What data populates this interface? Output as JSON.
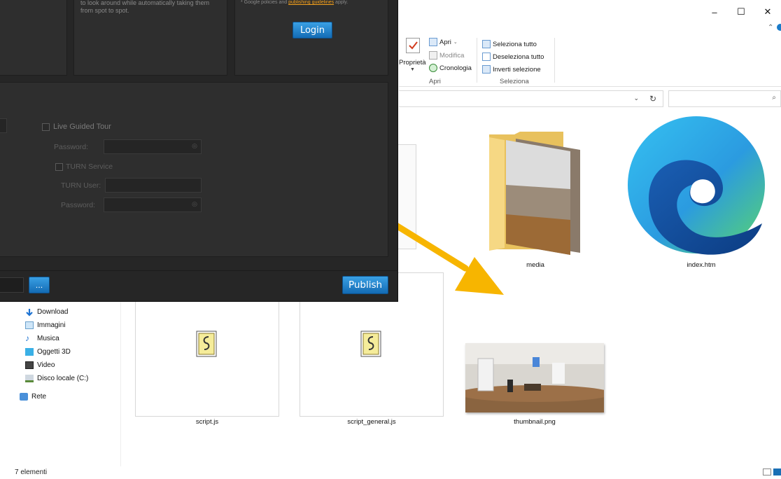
{
  "dialog": {
    "description_text_1": "to look around while automatically taking them",
    "description_text_2": "from spot to spot.",
    "policy_text": "* Google policies and ",
    "policy_link": "publishing guidelines",
    "policy_suffix": " apply.",
    "login_label": "Login",
    "live_guided_tour_label": "Live Guided Tour",
    "password_label": "Password:",
    "turn_service_label": "TURN Service",
    "turn_user_label": "TURN User:",
    "turn_password_label": "Password:",
    "browse_label": "...",
    "publish_label": "Publish"
  },
  "window": {
    "minimize": "–",
    "maximize": "☐",
    "close": "✕"
  },
  "ribbon": {
    "open_label": "Apri",
    "modify_label": "Modifica",
    "history_label": "Cronologia",
    "properties_label": "Proprietà",
    "select_all_label": "Seleziona tutto",
    "deselect_all_label": "Deseleziona tutto",
    "invert_selection_label": "Inverti selezione",
    "group_open": "Apri",
    "group_select": "Seleziona"
  },
  "nav": {
    "items": [
      {
        "label": "Download",
        "icon": "download-icon"
      },
      {
        "label": "Immagini",
        "icon": "pictures-icon"
      },
      {
        "label": "Musica",
        "icon": "music-icon"
      },
      {
        "label": "Oggetti 3D",
        "icon": "3d-objects-icon"
      },
      {
        "label": "Video",
        "icon": "video-icon"
      },
      {
        "label": "Disco locale (C:)",
        "icon": "drive-icon"
      },
      {
        "label": "Rete",
        "icon": "network-icon"
      }
    ]
  },
  "files": {
    "media": "media",
    "index": "index.htm",
    "script": "script.js",
    "script_general": "script_general.js",
    "thumbnail": "thumbnail.png"
  },
  "status": {
    "count": "7 elementi"
  },
  "colors": {
    "accent_blue": "#1a7bc9",
    "arrow_yellow": "#f7b500",
    "dialog_bg": "#262626"
  }
}
